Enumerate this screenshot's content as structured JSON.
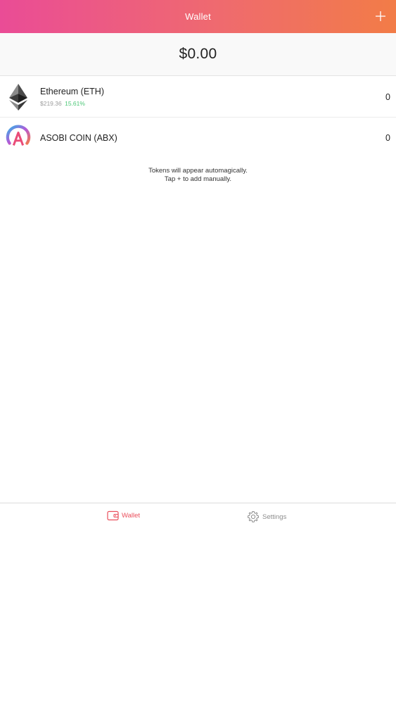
{
  "header": {
    "title": "Wallet",
    "add_icon": "plus-icon"
  },
  "balance": {
    "total": "$0.00"
  },
  "tokens": [
    {
      "name": "Ethereum (ETH)",
      "price": "$219.36",
      "change": "15.61%",
      "amount": "0",
      "icon": "ethereum-icon"
    },
    {
      "name": "ASOBI COIN (ABX)",
      "amount": "0",
      "icon": "asobi-coin-icon"
    }
  ],
  "hint": {
    "line1": "Tokens will appear automagically.",
    "line2": "Tap + to add manually."
  },
  "tabbar": {
    "wallet": {
      "label": "Wallet",
      "icon": "wallet-icon"
    },
    "settings": {
      "label": "Settings",
      "icon": "gear-icon"
    }
  },
  "colors": {
    "header_gradient_start": "#ea4c96",
    "header_gradient_end": "#f27c47",
    "active_tab": "#ea4f5c",
    "positive_change": "#4cc777",
    "muted_text": "#9b9b9b"
  }
}
